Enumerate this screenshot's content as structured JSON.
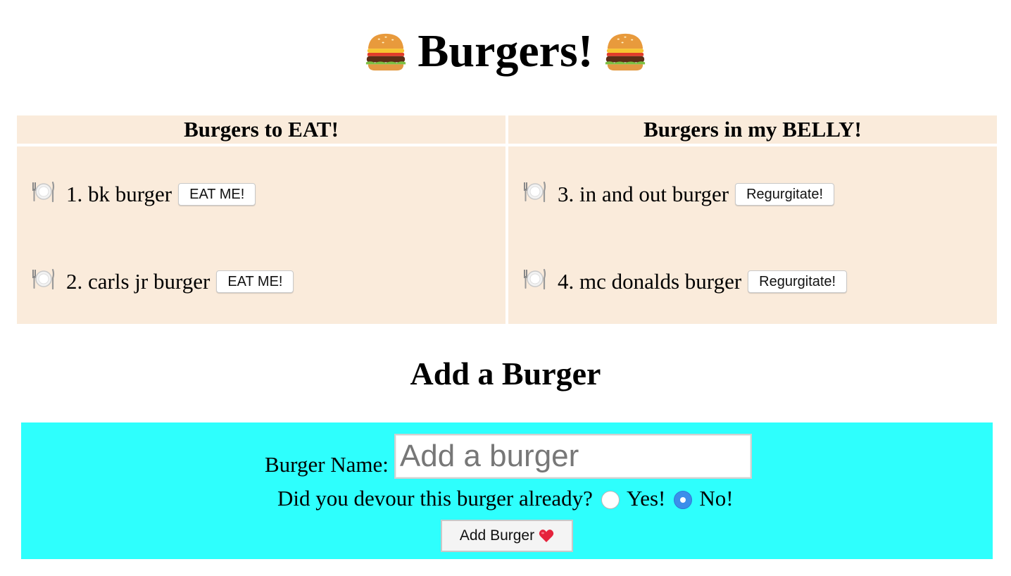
{
  "header": {
    "title": "Burgers!",
    "left_icon": "burger-icon",
    "right_icon": "burger-icon"
  },
  "columns": [
    {
      "heading": "Burgers to EAT!",
      "items": [
        {
          "icon": "plate-icon",
          "label": "1. bk burger",
          "button": "EAT ME!"
        },
        {
          "icon": "plate-icon",
          "label": "2. carls jr burger",
          "button": "EAT ME!"
        }
      ]
    },
    {
      "heading": "Burgers in my BELLY!",
      "items": [
        {
          "icon": "plate-icon",
          "label": "3. in and out burger",
          "button": "Regurgitate!"
        },
        {
          "icon": "plate-icon",
          "label": "4. mc donalds burger",
          "button": "Regurgitate!"
        }
      ]
    }
  ],
  "form": {
    "title": "Add a Burger",
    "name_label": "Burger Name:",
    "name_placeholder": "Add a burger",
    "name_value": "",
    "devour_question": "Did you devour this burger already?",
    "option_yes": "Yes!",
    "option_no": "No!",
    "selected_option": "No!",
    "submit_label": "Add Burger",
    "submit_icon": "heart-icon"
  },
  "colors": {
    "table_bg": "#faebdb",
    "form_bg": "#2efffd",
    "radio_selected": "#3b8eea"
  }
}
